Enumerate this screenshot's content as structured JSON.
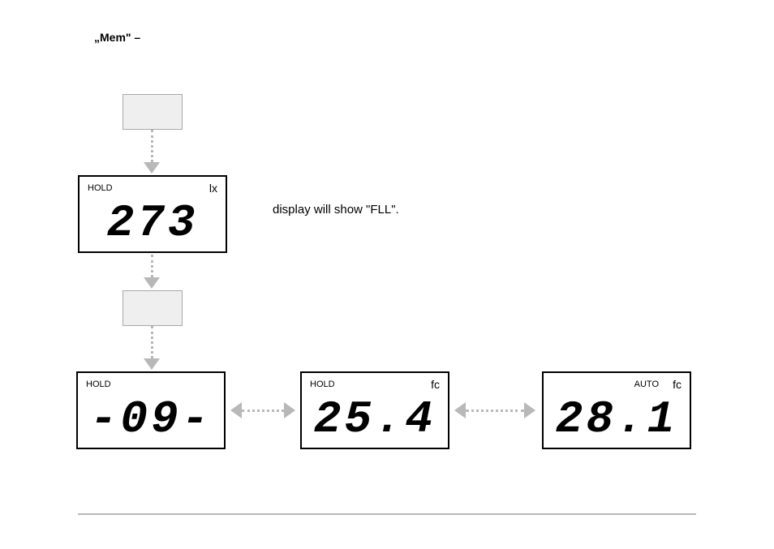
{
  "title": "„Mem\" –",
  "side_text": "display will show \"FLL\".",
  "displays": {
    "d1": {
      "hold": "HOLD",
      "unit": "lx",
      "value": "273"
    },
    "d2": {
      "hold": "HOLD",
      "value": "-09-"
    },
    "d3": {
      "hold": "HOLD",
      "unit": "fc",
      "value": "25.4"
    },
    "d4": {
      "auto": "AUTO",
      "unit": "fc",
      "value": "28.1"
    }
  }
}
